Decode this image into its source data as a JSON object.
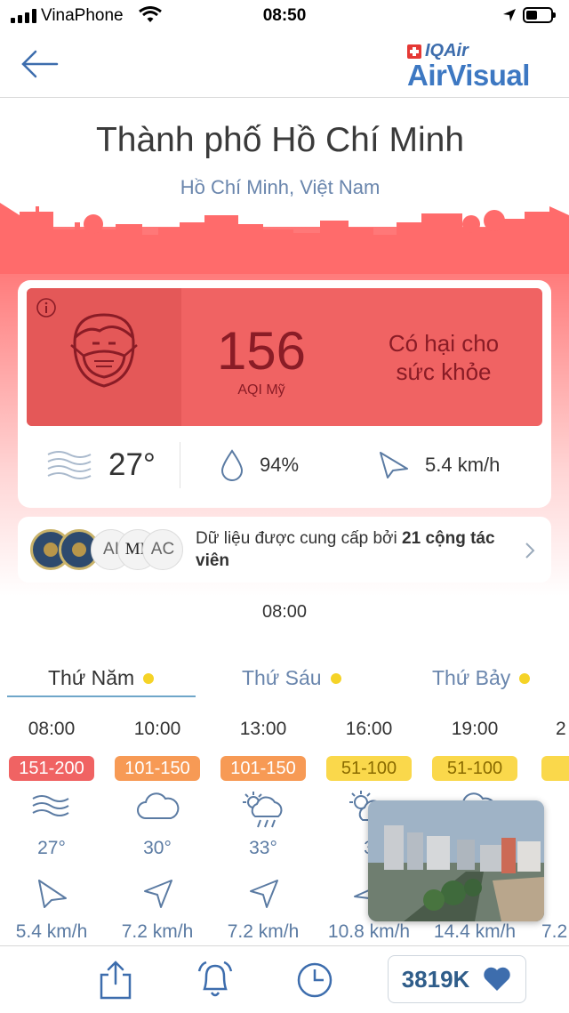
{
  "status_bar": {
    "carrier": "VinaPhone",
    "time": "08:50"
  },
  "header": {
    "brand_top": "IQAir",
    "brand_main": "AirVisual"
  },
  "location": {
    "city": "Thành phố Hồ Chí Minh",
    "region": "Hồ Chí Minh, Việt Nam"
  },
  "aqi": {
    "value": "156",
    "label": "AQI Mỹ",
    "status_line1": "Có hại cho",
    "status_line2": "sức khỏe",
    "color": "#f06363"
  },
  "weather": {
    "temperature": "27°",
    "humidity": "94%",
    "wind": "5.4 km/h"
  },
  "contributors": {
    "badges": [
      "AI",
      "ML",
      "AC"
    ],
    "text_prefix": "Dữ liệu được cung cấp bởi ",
    "text_bold": "21 cộng tác viên"
  },
  "current_time": "08:00",
  "day_tabs": [
    {
      "label": "Thứ Năm",
      "active": true
    },
    {
      "label": "Thứ Sáu",
      "active": false
    },
    {
      "label": "Thứ Bảy",
      "active": false
    }
  ],
  "forecast": [
    {
      "time": "08:00",
      "aqi": "151-200",
      "color": "#f06363",
      "text_color": "#ffffff",
      "icon": "wind-icon",
      "temp": "27°",
      "speed": "5.4 km/h"
    },
    {
      "time": "10:00",
      "aqi": "101-150",
      "color": "#f79a55",
      "text_color": "#ffffff",
      "icon": "cloud-icon",
      "temp": "30°",
      "speed": "7.2 km/h"
    },
    {
      "time": "13:00",
      "aqi": "101-150",
      "color": "#f79a55",
      "text_color": "#ffffff",
      "icon": "sun-rain-icon",
      "temp": "33°",
      "speed": "7.2 km/h"
    },
    {
      "time": "16:00",
      "aqi": "51-100",
      "color": "#fad84b",
      "text_color": "#8a6b00",
      "icon": "sun-cloud-icon",
      "temp": "3",
      "speed": "10.8 km/h"
    },
    {
      "time": "19:00",
      "aqi": "51-100",
      "color": "#fad84b",
      "text_color": "#8a6b00",
      "icon": "cloud-icon",
      "temp": "",
      "speed": "14.4 km/h"
    },
    {
      "time": "2",
      "aqi": "",
      "color": "#fad84b",
      "text_color": "#8a6b00",
      "icon": "cloud-icon",
      "temp": "",
      "speed": "7.2"
    }
  ],
  "tabbar": {
    "followers": "3819K"
  }
}
